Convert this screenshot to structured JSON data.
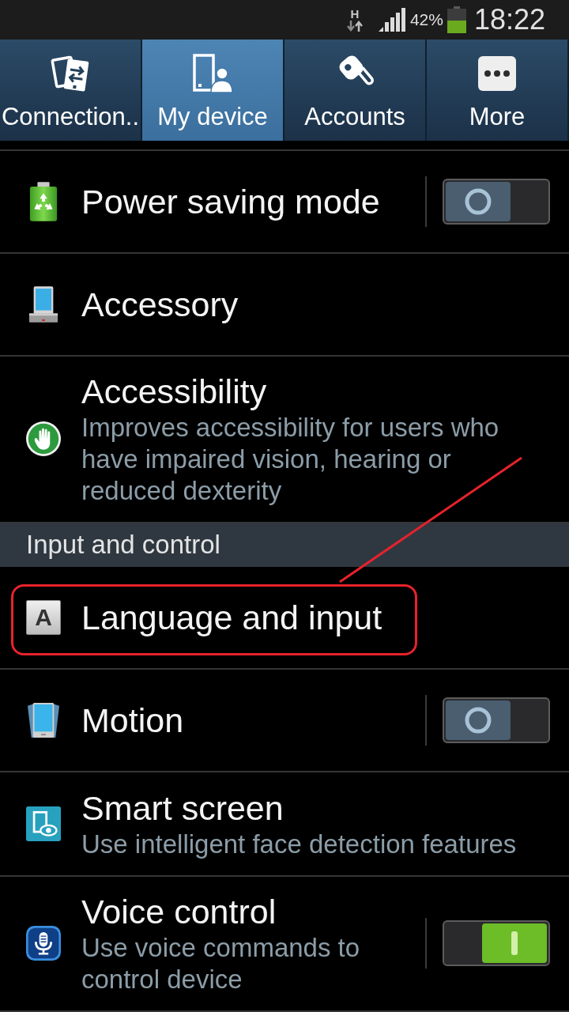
{
  "status_bar": {
    "network_type": "H",
    "battery": "42%",
    "time": "18:22"
  },
  "tabs": [
    {
      "label": "Connection..",
      "selected": false
    },
    {
      "label": "My device",
      "selected": true
    },
    {
      "label": "Accounts",
      "selected": false
    },
    {
      "label": "More",
      "selected": false
    }
  ],
  "items": [
    {
      "kind": "switch",
      "title": "Power saving mode",
      "on": false,
      "highlighted": false
    },
    {
      "kind": "link",
      "title": "Accessory",
      "highlighted": false
    },
    {
      "kind": "link",
      "title": "Accessibility",
      "description": "Improves accessibility for users who have impaired vision, hearing or reduced dexterity",
      "highlighted": false
    },
    {
      "kind": "header",
      "title": "Input and control"
    },
    {
      "kind": "link",
      "title": "Language and input",
      "icon_letter": "A",
      "highlighted": true
    },
    {
      "kind": "switch",
      "title": "Motion",
      "on": false,
      "highlighted": false
    },
    {
      "kind": "link",
      "title": "Smart screen",
      "description": "Use intelligent face detection features",
      "highlighted": false
    },
    {
      "kind": "switch",
      "title": "Voice control",
      "description": "Use voice commands to control device",
      "on": true,
      "highlighted": false
    }
  ]
}
